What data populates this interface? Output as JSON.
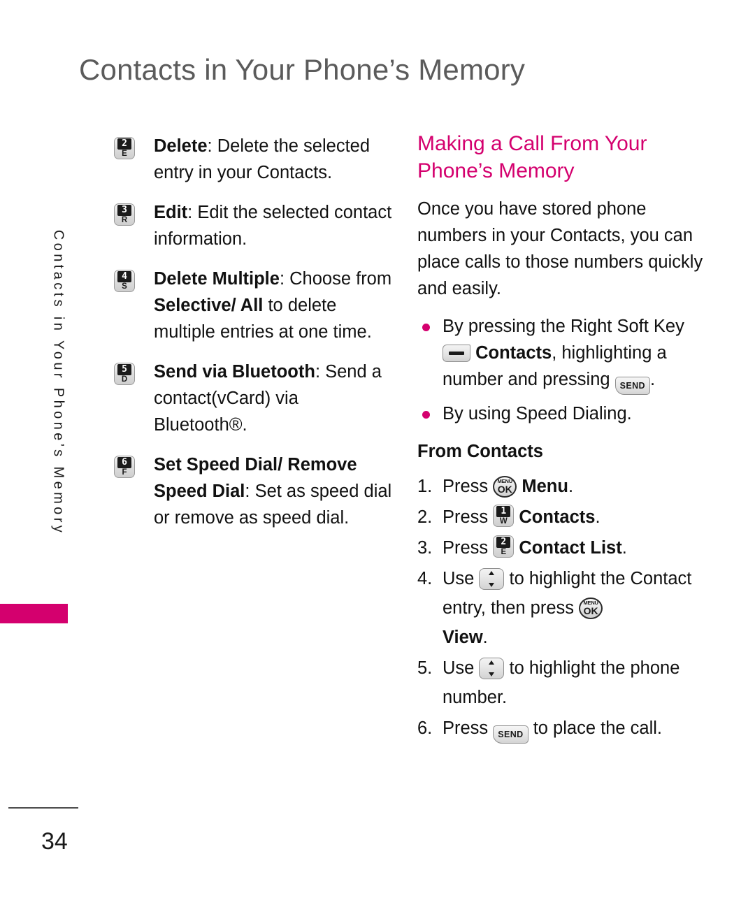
{
  "page": {
    "title": "Contacts in Your Phone’s Memory",
    "side_tab_text": "Contacts in Your Phone’s Memory",
    "page_number": "34",
    "accent_color": "#d4006e",
    "title_color": "#5b5b5b"
  },
  "left_column": {
    "options": [
      {
        "key_digit": "2",
        "key_letter": "E",
        "key_icon": "keypad-2-e-icon",
        "term": "Delete",
        "separator": ":",
        "description": " Delete the selected entry in your Contacts."
      },
      {
        "key_digit": "3",
        "key_letter": "R",
        "key_icon": "keypad-3-r-icon",
        "term": "Edit",
        "separator": ":",
        "description": " Edit the selected contact information."
      },
      {
        "key_digit": "4",
        "key_letter": "S",
        "key_icon": "keypad-4-s-icon",
        "term": "Delete Multiple",
        "separator": ":",
        "description_part1": " Choose from ",
        "emphasis1": "Selective/ All",
        "description_part2": " to delete multiple entries at one time."
      },
      {
        "key_digit": "5",
        "key_letter": "D",
        "key_icon": "keypad-5-d-icon",
        "term": "Send via Bluetooth",
        "separator": ":",
        "description": " Send a contact(vCard) via Bluetooth®."
      },
      {
        "key_digit": "6",
        "key_letter": "F",
        "key_icon": "keypad-6-f-icon",
        "term": "Set Speed Dial/ Remove Speed Dial",
        "separator": ":",
        "description": " Set as speed dial or remove as speed dial."
      }
    ]
  },
  "right_column": {
    "heading": "Making a Call From Your Phone’s Memory",
    "intro": "Once you have stored phone numbers in your Contacts, you can place calls to those numbers quickly and easily.",
    "bullets": [
      {
        "text_part1": "By pressing the Right Soft Key ",
        "soft_key_icon": "right-soft-key-icon",
        "emphasis": "Contacts",
        "text_part2": ", highlighting a number and pressing ",
        "send_key_icon": "send-key-icon",
        "send_key_label": "SEND",
        "text_part3": "."
      },
      {
        "text_part1": "By using Speed Dialing."
      }
    ],
    "sub_heading": "From Contacts",
    "steps": [
      {
        "num": "1.",
        "verb": "Press ",
        "key": "menu-ok",
        "key_menu_label": "MENU",
        "key_ok_label": "OK",
        "key_icon": "menu-ok-key-icon",
        "after_bold": "Menu",
        "after_tail": "."
      },
      {
        "num": "2.",
        "verb": "Press ",
        "key": "num",
        "key_digit": "1",
        "key_letter": "W",
        "key_icon": "keypad-1-w-icon",
        "after_bold": "Contacts",
        "after_tail": "."
      },
      {
        "num": "3.",
        "verb": "Press ",
        "key": "num",
        "key_digit": "2",
        "key_letter": "E",
        "key_icon": "keypad-2-e-icon",
        "after_bold": "Contact List",
        "after_tail": "."
      },
      {
        "num": "4.",
        "verb": "Use ",
        "key": "nav",
        "key_icon": "navigation-updown-key-icon",
        "mid_text": " to highlight the Contact entry, then press ",
        "key2": "menu-ok",
        "key2_icon": "menu-ok-key-icon",
        "key2_menu_label": "MENU",
        "key2_ok_label": "OK",
        "after_bold": "View",
        "after_tail": "."
      },
      {
        "num": "5.",
        "verb": "Use ",
        "key": "nav",
        "key_icon": "navigation-updown-key-icon",
        "mid_text": " to highlight the phone number."
      },
      {
        "num": "6.",
        "verb": "Press ",
        "key": "send",
        "key_icon": "send-key-icon",
        "key_label": "SEND",
        "mid_text": " to place the call."
      }
    ]
  }
}
